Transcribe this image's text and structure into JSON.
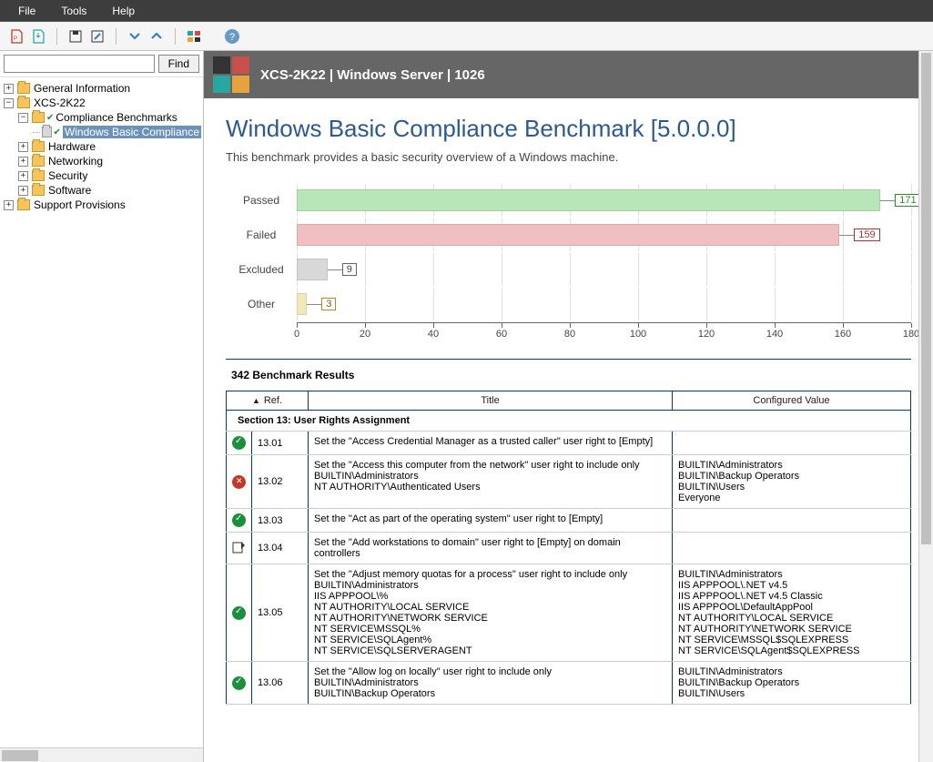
{
  "menubar": {
    "file": "File",
    "tools": "Tools",
    "help": "Help"
  },
  "search": {
    "find": "Find"
  },
  "tree": {
    "general_info": "General Information",
    "host": "XCS-2K22",
    "compliance": "Compliance Benchmarks",
    "windows_basic": "Windows Basic Compliance",
    "hardware": "Hardware",
    "networking": "Networking",
    "security": "Security",
    "software": "Software",
    "support": "Support Provisions"
  },
  "header": {
    "title": "XCS-2K22 | Windows Server | 1026"
  },
  "page": {
    "title": "Windows Basic Compliance Benchmark [5.0.0.0]",
    "desc": "This benchmark provides a basic security overview of a Windows machine."
  },
  "chart_labels": {
    "passed": "Passed",
    "failed": "Failed",
    "excluded": "Excluded",
    "other": "Other"
  },
  "chart_data": {
    "type": "bar",
    "orientation": "horizontal",
    "categories": [
      "Passed",
      "Failed",
      "Excluded",
      "Other"
    ],
    "values": [
      171,
      159,
      9,
      3
    ],
    "colors": [
      "#b8e6b8",
      "#f0c0c0",
      "#d8d8d8",
      "#f5e8b8"
    ],
    "xlim": [
      0,
      180
    ],
    "ticks": [
      0,
      20,
      40,
      60,
      80,
      100,
      120,
      140,
      160,
      180
    ],
    "title": "",
    "xlabel": "",
    "ylabel": ""
  },
  "results": {
    "count_label": "342 Benchmark Results",
    "col_ref": "Ref.",
    "col_title": "Title",
    "col_value": "Configured Value",
    "section": "Section 13: User Rights Assignment",
    "rows": [
      {
        "status": "pass",
        "ref": "13.01",
        "title": "Set the \"Access Credential Manager as a trusted caller\" user right to [Empty]",
        "value": ""
      },
      {
        "status": "fail",
        "ref": "13.02",
        "title": "Set the \"Access this computer from the network\" user right to include only\nBUILTIN\\Administrators\nNT AUTHORITY\\Authenticated Users",
        "value": "BUILTIN\\Administrators\nBUILTIN\\Backup Operators\nBUILTIN\\Users\nEveryone"
      },
      {
        "status": "pass",
        "ref": "13.03",
        "title": "Set the \"Act as part of the operating system\" user right to [Empty]",
        "value": ""
      },
      {
        "status": "unk",
        "ref": "13.04",
        "title": "Set the \"Add workstations to domain\" user right to [Empty] on domain controllers",
        "value": ""
      },
      {
        "status": "pass",
        "ref": "13.05",
        "title": "Set the \"Adjust memory quotas for a process\" user right to include only\nBUILTIN\\Administrators\nIIS APPPOOL\\%\nNT AUTHORITY\\LOCAL SERVICE\nNT AUTHORITY\\NETWORK SERVICE\nNT SERVICE\\MSSQL%\nNT SERVICE\\SQLAgent%\nNT SERVICE\\SQLSERVERAGENT",
        "value": "BUILTIN\\Administrators\nIIS APPPOOL\\.NET v4.5\nIIS APPPOOL\\.NET v4.5 Classic\nIIS APPPOOL\\DefaultAppPool\nNT AUTHORITY\\LOCAL SERVICE\nNT AUTHORITY\\NETWORK SERVICE\nNT SERVICE\\MSSQL$SQLEXPRESS\nNT SERVICE\\SQLAgent$SQLEXPRESS"
      },
      {
        "status": "pass",
        "ref": "13.06",
        "title": "Set the \"Allow log on locally\" user right to include only\nBUILTIN\\Administrators\nBUILTIN\\Backup Operators",
        "value": "BUILTIN\\Administrators\nBUILTIN\\Backup Operators\nBUILTIN\\Users"
      }
    ]
  }
}
